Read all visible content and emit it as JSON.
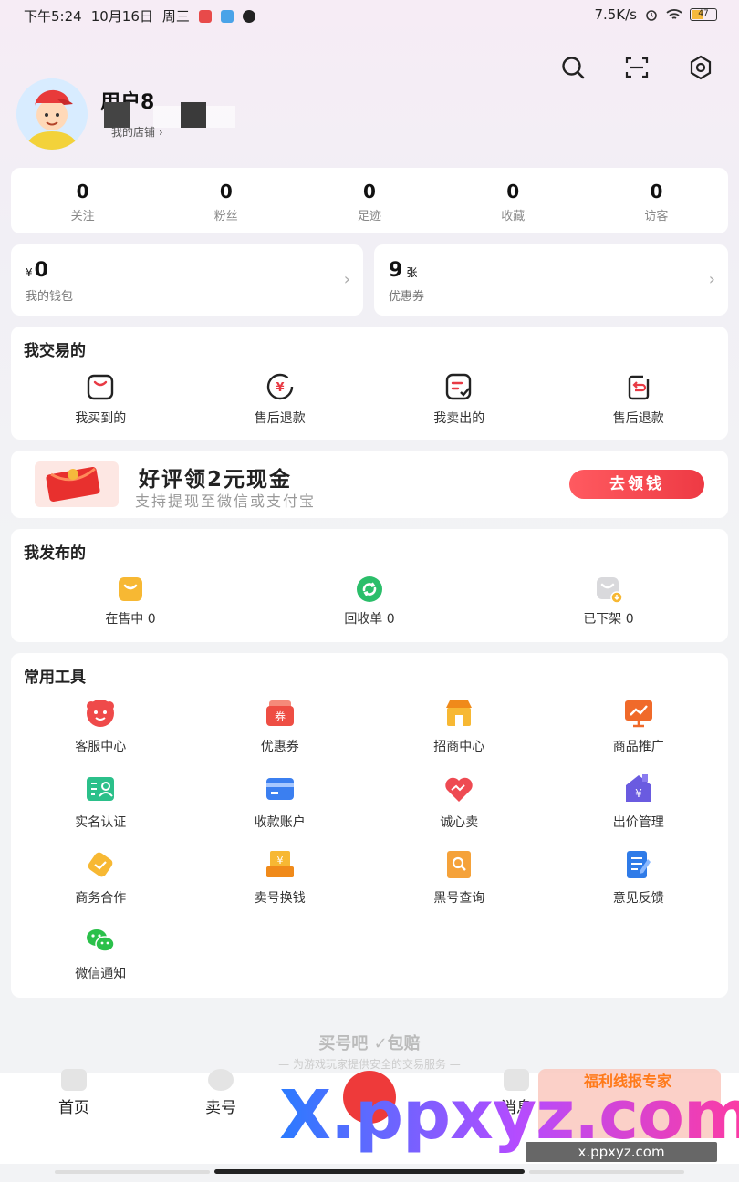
{
  "status_bar": {
    "time": "下午5:24",
    "date": "10月16日",
    "weekday": "周三",
    "network_speed": "7.5K/s",
    "battery": "47"
  },
  "profile": {
    "username": "用户8",
    "shop_link": "我的店铺 ›"
  },
  "stats": [
    {
      "value": "0",
      "label": "关注"
    },
    {
      "value": "0",
      "label": "粉丝"
    },
    {
      "value": "0",
      "label": "足迹"
    },
    {
      "value": "0",
      "label": "收藏"
    },
    {
      "value": "0",
      "label": "访客"
    }
  ],
  "wallet": {
    "currency": "¥",
    "amount": "0",
    "label": "我的钱包"
  },
  "coupons": {
    "count": "9",
    "unit": "张",
    "label": "优惠券"
  },
  "trade": {
    "title": "我交易的",
    "items": [
      {
        "label": "我买到的",
        "icon": "shopping-bag-icon"
      },
      {
        "label": "售后退款",
        "icon": "yuan-refund-icon"
      },
      {
        "label": "我卖出的",
        "icon": "sold-check-icon"
      },
      {
        "label": "售后退款",
        "icon": "return-icon"
      }
    ]
  },
  "banner": {
    "title": "好评领2元现金",
    "subtitle": "支持提现至微信或支付宝",
    "button": "去领钱"
  },
  "publish": {
    "title": "我发布的",
    "items": [
      {
        "label": "在售中 0",
        "icon": "on-sale-icon"
      },
      {
        "label": "回收单 0",
        "icon": "recycle-icon"
      },
      {
        "label": "已下架 0",
        "icon": "delisted-icon"
      }
    ]
  },
  "tools": {
    "title": "常用工具",
    "items": [
      {
        "label": "客服中心",
        "icon": "customer-service-icon"
      },
      {
        "label": "优惠券",
        "icon": "coupon-icon"
      },
      {
        "label": "招商中心",
        "icon": "store-icon"
      },
      {
        "label": "商品推广",
        "icon": "promotion-icon"
      },
      {
        "label": "实名认证",
        "icon": "id-card-icon"
      },
      {
        "label": "收款账户",
        "icon": "bank-card-icon"
      },
      {
        "label": "诚心卖",
        "icon": "heart-icon"
      },
      {
        "label": "出价管理",
        "icon": "bid-house-icon"
      },
      {
        "label": "商务合作",
        "icon": "cooperation-icon"
      },
      {
        "label": "卖号换钱",
        "icon": "sell-account-icon"
      },
      {
        "label": "黑号查询",
        "icon": "blacklist-search-icon"
      },
      {
        "label": "意见反馈",
        "icon": "feedback-icon"
      },
      {
        "label": "微信通知",
        "icon": "wechat-icon"
      }
    ]
  },
  "footer": {
    "brand": "买号吧 ✓包赔",
    "tagline": "— 为游戏玩家提供安全的交易服务 —"
  },
  "tabbar": [
    {
      "label": "首页"
    },
    {
      "label": "卖号"
    },
    {
      "label": "消息"
    }
  ],
  "watermark": {
    "text": "X.ppxyz.com",
    "url": "x.ppxyz.com",
    "badge": "福利线报专家"
  },
  "colors": {
    "accent_red": "#EE3A44",
    "yellow": "#F5B93C",
    "green": "#2BBE6A"
  }
}
